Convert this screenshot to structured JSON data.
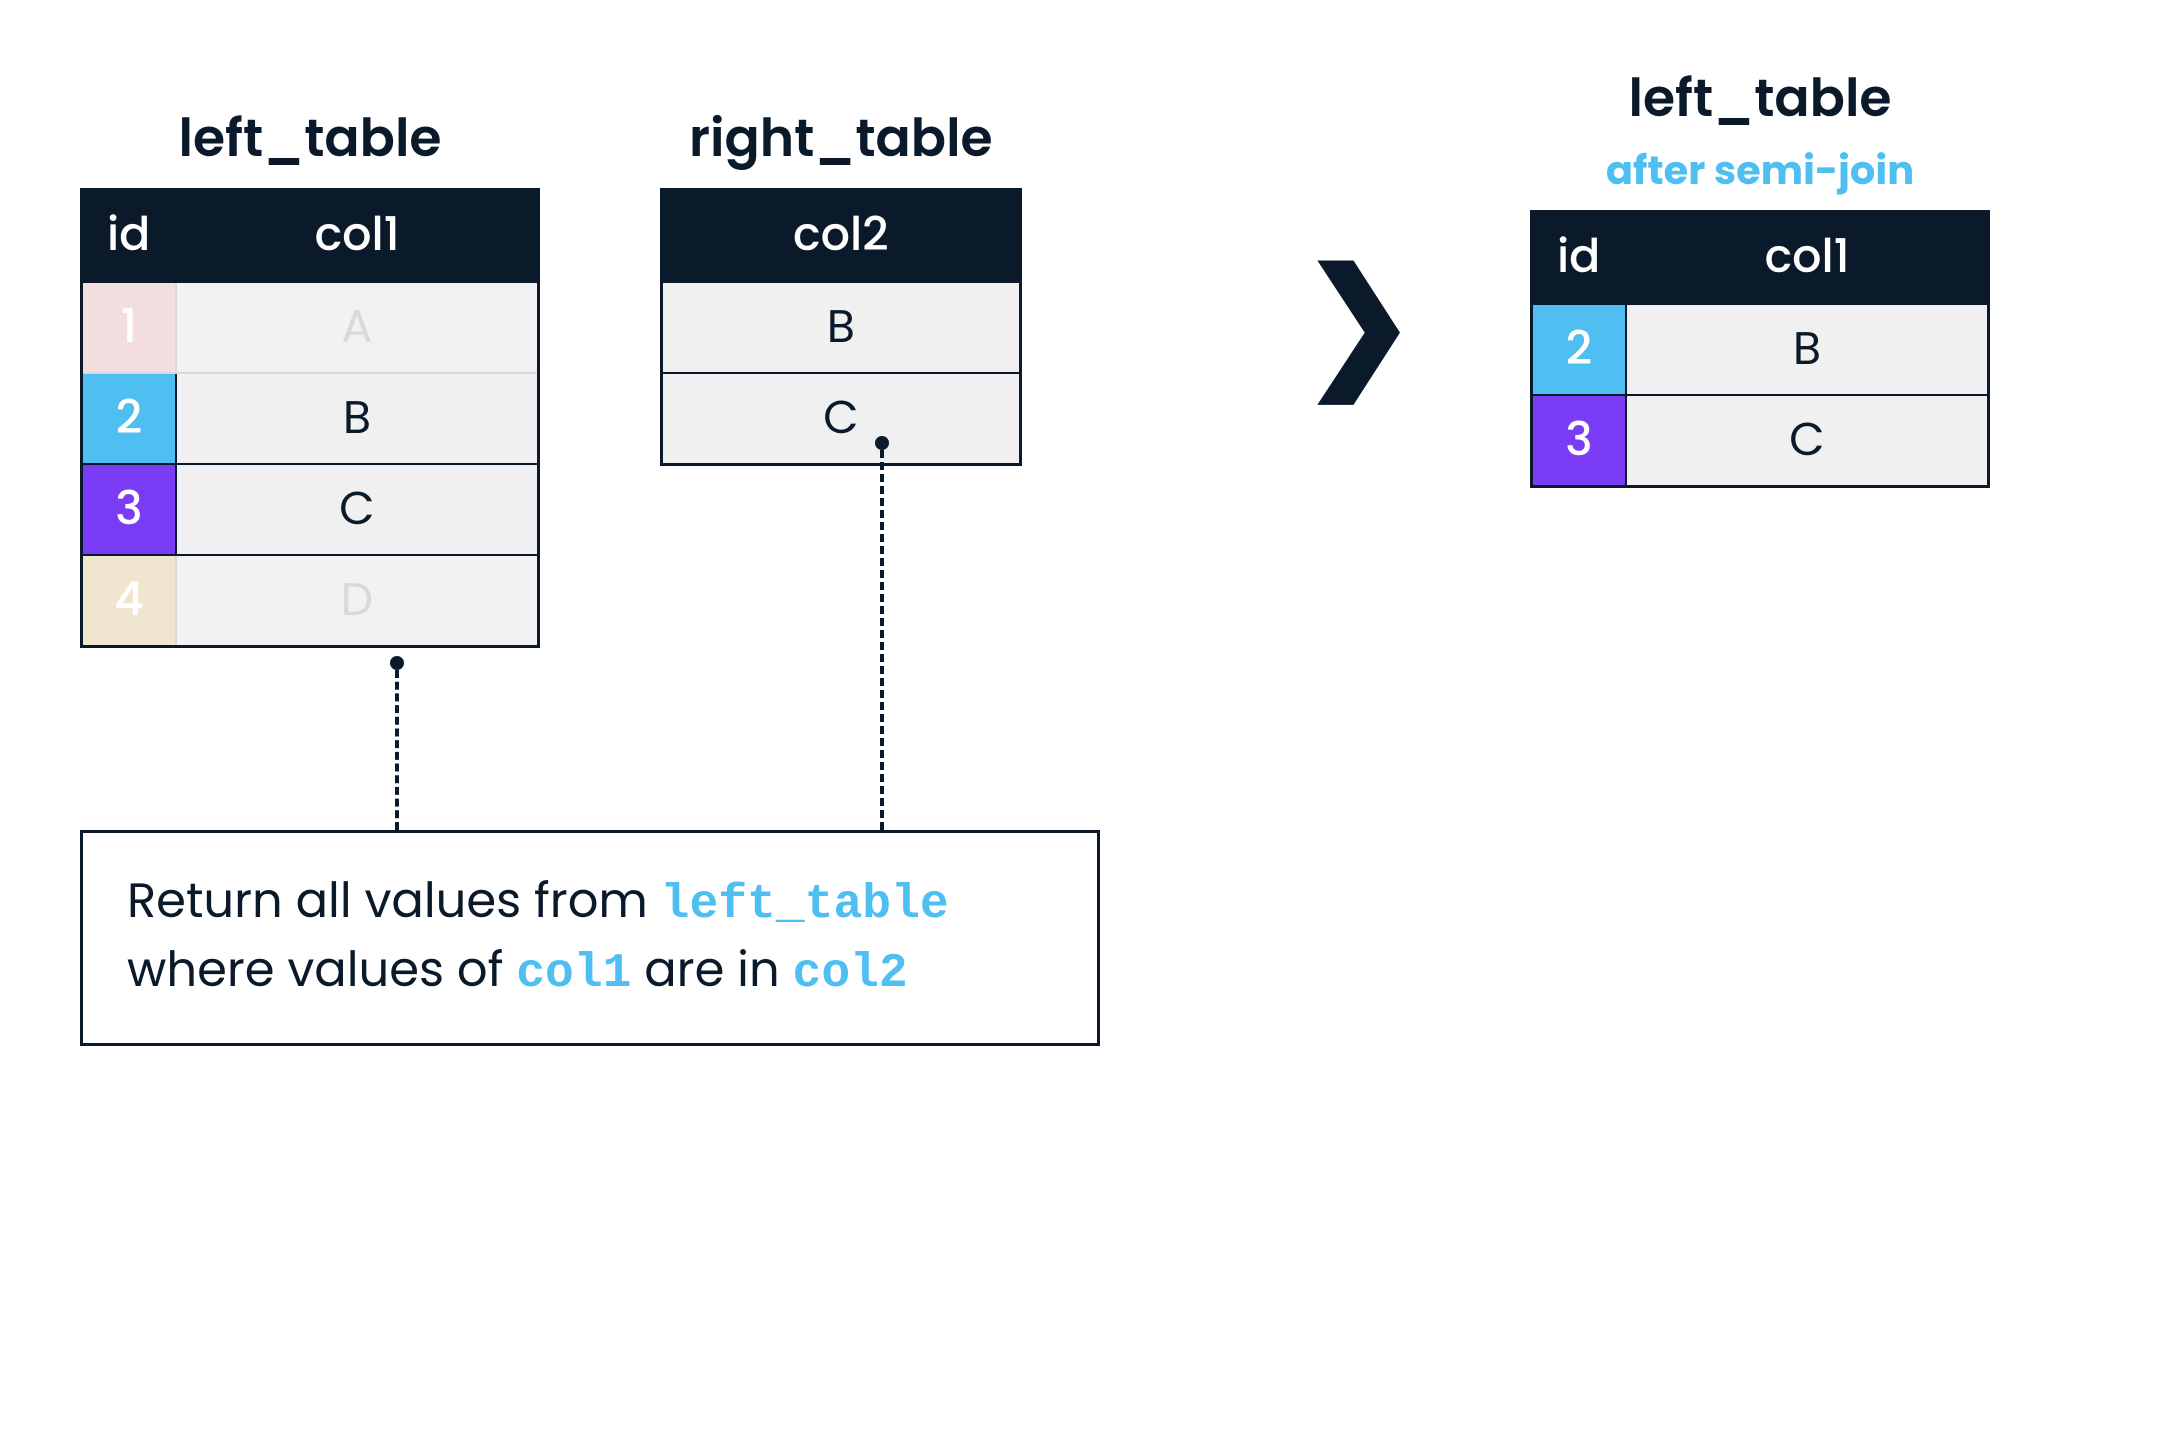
{
  "left_table": {
    "title": "left_table",
    "headers": {
      "id": "id",
      "col1": "col1"
    },
    "rows": [
      {
        "id": "1",
        "col1": "A",
        "color": "pink",
        "faded": true
      },
      {
        "id": "2",
        "col1": "B",
        "color": "blue",
        "faded": false
      },
      {
        "id": "3",
        "col1": "C",
        "color": "purple",
        "faded": false
      },
      {
        "id": "4",
        "col1": "D",
        "color": "cream",
        "faded": true
      }
    ]
  },
  "right_table": {
    "title": "right_table",
    "header": "col2",
    "rows": [
      "B",
      "C"
    ]
  },
  "result_table": {
    "title": "left_table",
    "subtitle": "after semi-join",
    "headers": {
      "id": "id",
      "col1": "col1"
    },
    "rows": [
      {
        "id": "2",
        "col1": "B",
        "color": "blue"
      },
      {
        "id": "3",
        "col1": "C",
        "color": "purple"
      }
    ]
  },
  "explanation": {
    "prefix": "Return all values from ",
    "kw1": "left_table",
    "mid1": " where values of ",
    "kw2": "col1",
    "mid2": " are in ",
    "kw3": "col2"
  },
  "arrow_glyph": "❯"
}
